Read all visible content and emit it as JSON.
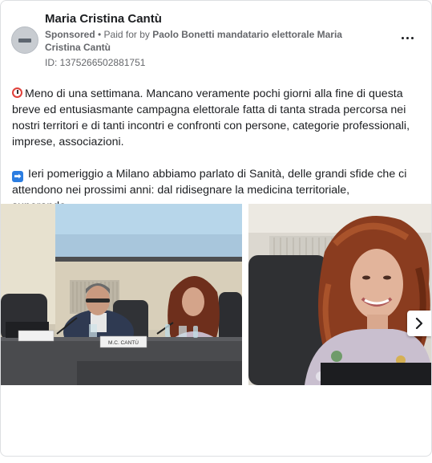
{
  "post": {
    "page_name": "Maria Cristina Cantù",
    "sponsored_label": "Sponsored",
    "paid_for_prefix": " • Paid for by ",
    "paid_for_by": "Paolo Bonetti mandatario elettorale Maria Cristina Cantù",
    "ad_id": "ID: 1375266502881751",
    "paragraph1": "Meno di una settimana. Mancano veramente pochi giorni alla fine di questa breve ed entusiasmante campagna elettorale fatta di tanta strada percorsa nei nostri territori e di tanti incontri e confronti con persone, categorie professionali, imprese, associazioni.",
    "paragraph2": "Ieri pomeriggio a Milano abbiamo parlato di Sanità, delle grandi sfide che ci attendono nei prossimi anni: dal ridisegnare la medicina territoriale, superando…",
    "emoji1": "alarm-clock-icon",
    "emoji2": "right-arrow-icon"
  },
  "media": {
    "photo1_nameplate_left": "",
    "photo1_nameplate_right": "M.C. CANTÙ",
    "next_icon": "chevron-right-icon"
  },
  "colors": {
    "meta_gray": "#65676b",
    "border": "#dddfe2",
    "text": "#1c1e21"
  }
}
